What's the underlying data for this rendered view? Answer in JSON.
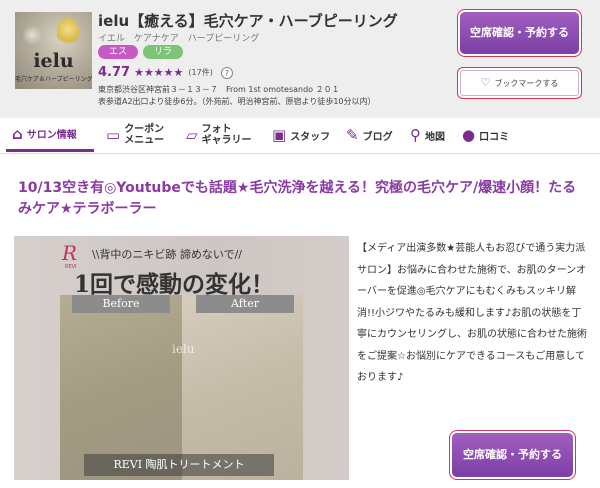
{
  "header": {
    "logo_name": "ielu",
    "logo_sub": "毛穴ケア＆ハーブピーリング",
    "salon_name": "ielu【癒える】毛穴ケア・ハーブピーリング",
    "salon_kana": "イエル　ケアナケア　ハーブピーリング",
    "tags": [
      "エステ",
      "リラク"
    ],
    "rating_score": "4.77",
    "rating_stars": "★★★★★",
    "rating_count": "(17件)",
    "help_label": "?",
    "address_line1": "東京都渋谷区神宮前３－１３－７　From 1st omotesando ２０１",
    "address_line2": "表参道A2出口より徒歩6分。（外苑前、明治神宮前、原宿より徒歩10分以内）",
    "reserve_label": "空席確認・予約する",
    "bookmark_label": "ブックマークする"
  },
  "nav": {
    "items": [
      {
        "label": "サロン情報",
        "icon": "home-icon"
      },
      {
        "label_line1": "クーポン",
        "label_line2": "メニュー",
        "icon": "coupon-icon"
      },
      {
        "label_line1": "フォト",
        "label_line2": "ギャラリー",
        "icon": "photo-icon"
      },
      {
        "label": "スタッフ",
        "icon": "staff-icon"
      },
      {
        "label": "ブログ",
        "icon": "pen-icon"
      },
      {
        "label": "地図",
        "icon": "map-pin-icon"
      },
      {
        "label": "口コミ",
        "icon": "comment-icon"
      }
    ]
  },
  "main": {
    "headline": "10/13空き有◎Youtubeでも話題★毛穴洗浄を越える！究極の毛穴ケア/爆速小顔！たるみケア★テラボーラー",
    "photo": {
      "revi_logo": "R",
      "revi_text": "REVI",
      "caption1": "\\\\背中のニキビ跡 諦めないで//",
      "caption2": "1回で感動の変化！",
      "before": "Before",
      "after": "After",
      "watermark": "ielu",
      "bottom_label": "REVI 陶肌トリートメント"
    },
    "description": "【メディア出演多数★芸能人もお忍びで通う実力派サロン】お悩みに合わせた施術で、お肌のターンオーバーを促進◎毛穴ケアにもむくみもスッキリ解消!!小ジワやたるみも緩和します♪お肌の状態を丁寧にカウンセリングし、お肌の状態に合わせた施術をご提案☆お悩別にケアできるコースもご用意しております♪",
    "reserve_label": "空席確認・予約する"
  },
  "colors": {
    "accent": "#7b2d8e",
    "headline": "#8a3aa3",
    "button_border": "#d7335b"
  }
}
